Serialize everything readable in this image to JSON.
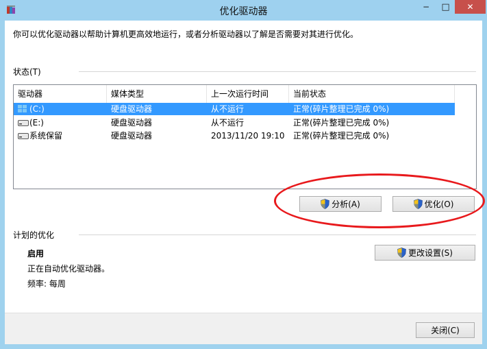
{
  "window": {
    "title": "优化驱动器",
    "minimize_symbol": "−",
    "maximize_symbol": "□",
    "close_symbol": "✕"
  },
  "intro": "你可以优化驱动器以帮助计算机更高效地运行，或者分析驱动器以了解是否需要对其进行优化。",
  "status_section": {
    "label": "状态(T)",
    "columns": [
      "驱动器",
      "媒体类型",
      "上一次运行时间",
      "当前状态"
    ],
    "rows": [
      {
        "drive": "(C:)",
        "media": "硬盘驱动器",
        "last_run": "从不运行",
        "status": "正常(碎片整理已完成 0%)",
        "icon": "windows-drive-icon",
        "selected": true
      },
      {
        "drive": "(E:)",
        "media": "硬盘驱动器",
        "last_run": "从不运行",
        "status": "正常(碎片整理已完成 0%)",
        "icon": "hard-drive-icon",
        "selected": false
      },
      {
        "drive": "系统保留",
        "media": "硬盘驱动器",
        "last_run": "2013/11/20 19:10",
        "status": "正常(碎片整理已完成 0%)",
        "icon": "hard-drive-icon",
        "selected": false
      }
    ],
    "analyze_button": "分析(A)",
    "optimize_button": "优化(O)"
  },
  "schedule_section": {
    "label": "计划的优化",
    "state": "启用",
    "description": "正在自动优化驱动器。",
    "frequency": "频率: 每周",
    "change_settings_button": "更改设置(S)"
  },
  "footer": {
    "close_button": "关闭(C)"
  },
  "colors": {
    "titlebar": "#9ed1ef",
    "selection": "#3399ff",
    "close_button": "#c7504b",
    "annotation": "#e8191c"
  }
}
